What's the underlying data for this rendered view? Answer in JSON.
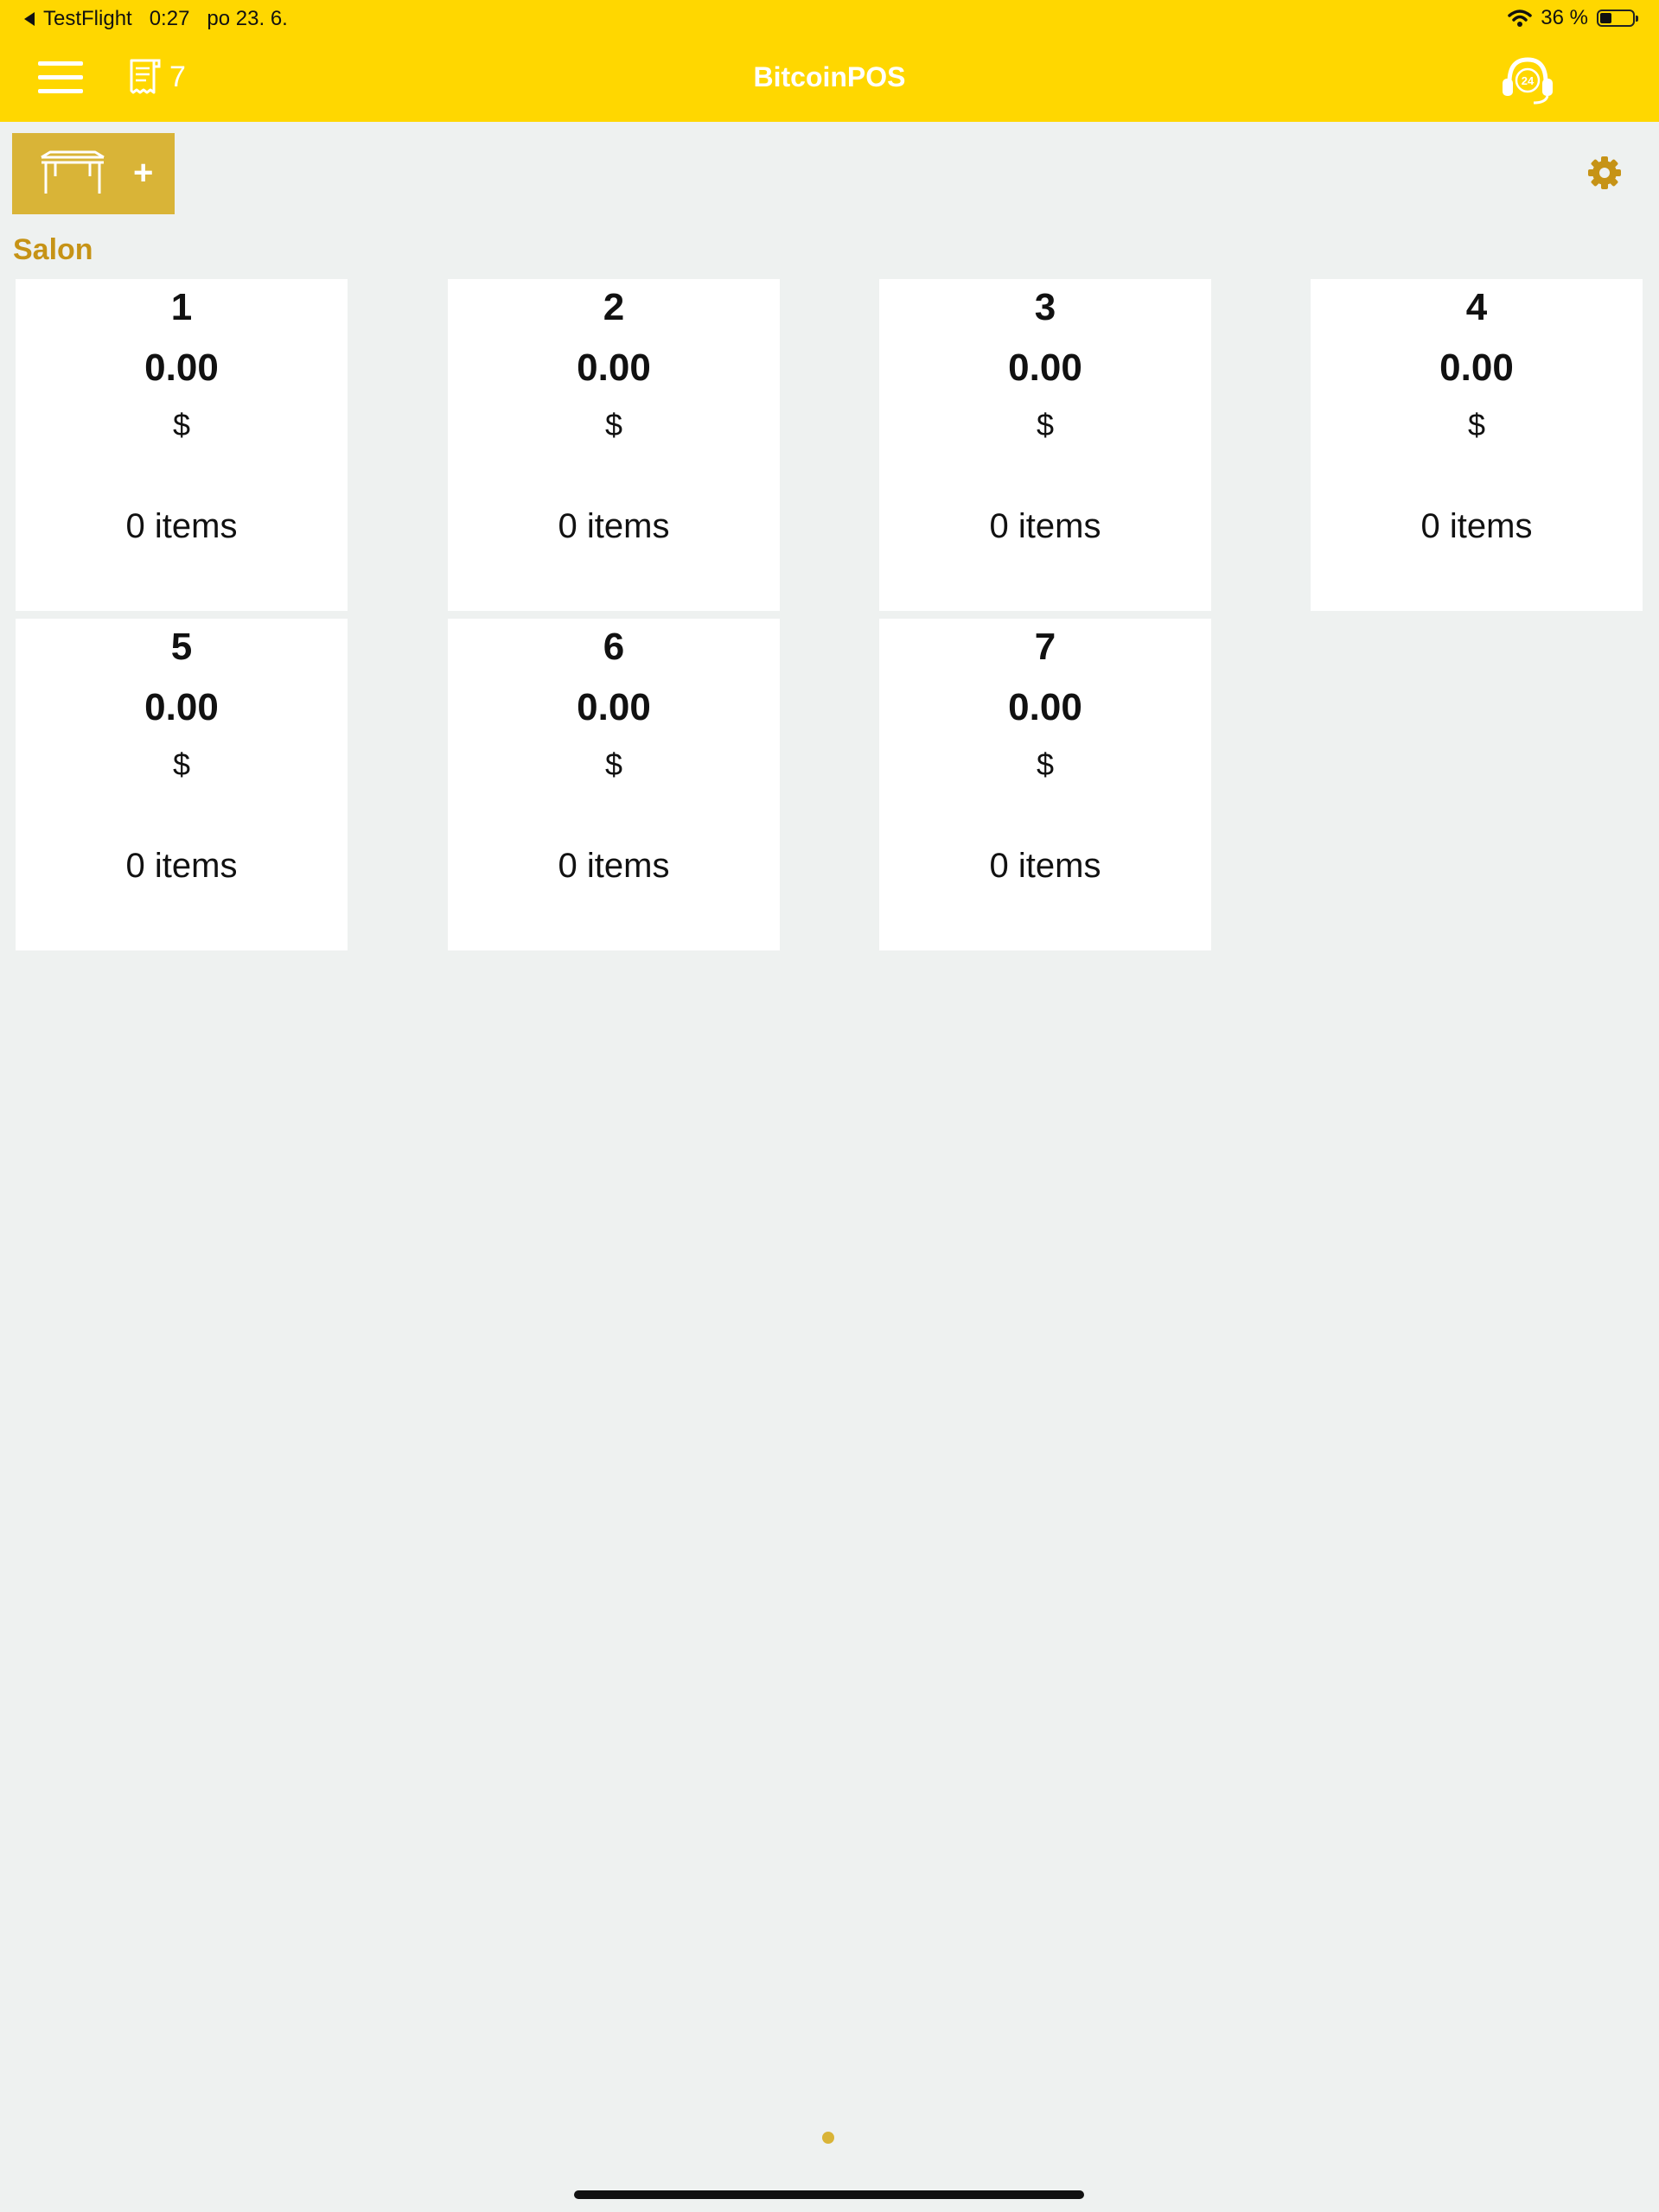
{
  "status_bar": {
    "back_app": "TestFlight",
    "time": "0:27",
    "date": "po 23. 6.",
    "battery_text": "36 %",
    "battery_level": 0.36
  },
  "header": {
    "title": "BitcoinPOS",
    "orders_count": "7",
    "menu_icon": "hamburger-icon",
    "orders_icon": "receipt-icon",
    "support_icon": "headset-24-icon",
    "support_icon_text": "24"
  },
  "toolbar": {
    "add_table_icon": "table-icon",
    "add_table_plus": "+",
    "settings_icon": "gear-icon"
  },
  "section": {
    "name": "Salon"
  },
  "tables": [
    {
      "number": "1",
      "total": "0.00",
      "currency": "$",
      "items": "0 items"
    },
    {
      "number": "2",
      "total": "0.00",
      "currency": "$",
      "items": "0 items"
    },
    {
      "number": "3",
      "total": "0.00",
      "currency": "$",
      "items": "0 items"
    },
    {
      "number": "4",
      "total": "0.00",
      "currency": "$",
      "items": "0 items"
    },
    {
      "number": "5",
      "total": "0.00",
      "currency": "$",
      "items": "0 items"
    },
    {
      "number": "6",
      "total": "0.00",
      "currency": "$",
      "items": "0 items"
    },
    {
      "number": "7",
      "total": "0.00",
      "currency": "$",
      "items": "0 items"
    }
  ],
  "pagination": {
    "page_count": 1,
    "current_page": 1
  },
  "colors": {
    "header_yellow": "#FFD700",
    "accent_gold": "#D9B437",
    "section_title": "#C69316",
    "background": "#EEF1F0"
  }
}
